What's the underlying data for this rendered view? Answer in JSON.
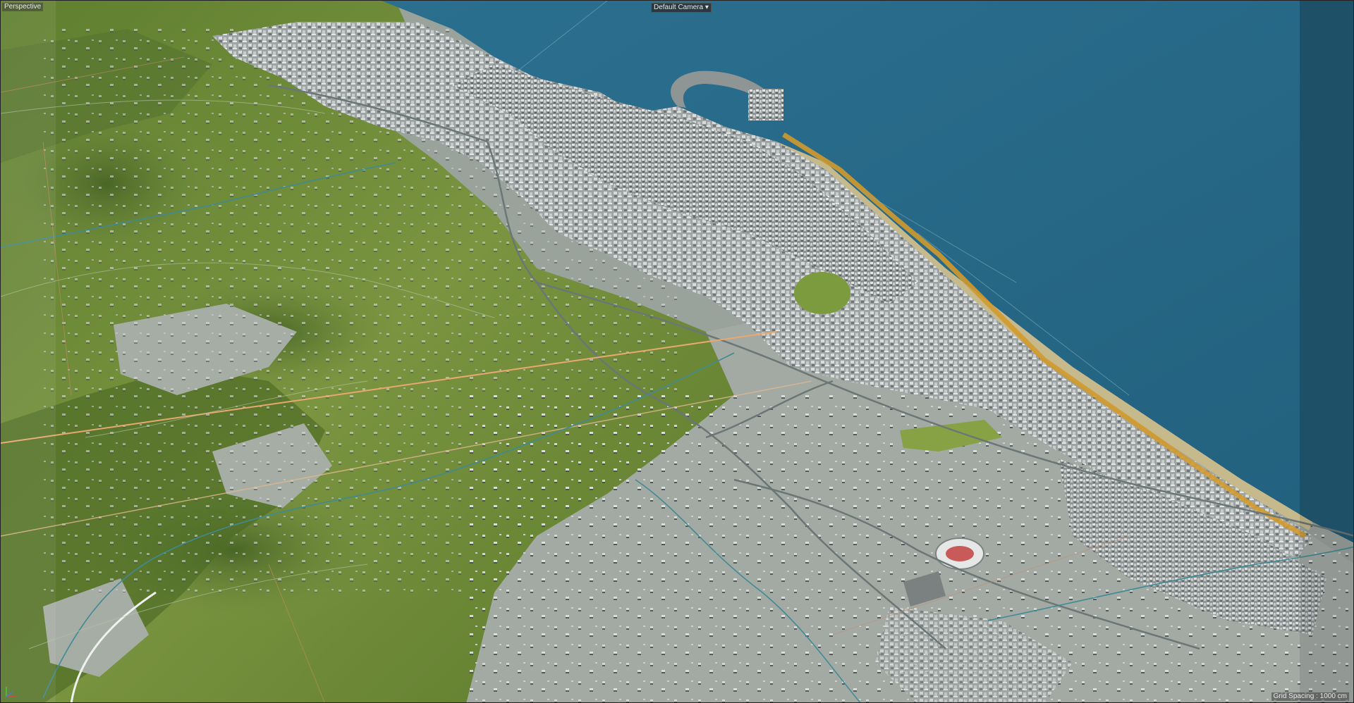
{
  "viewport": {
    "view_label": "Perspective",
    "camera_label": "Default Camera",
    "camera_icon": "camera-dropdown-icon",
    "grid_label": "Grid Spacing : 1000 cm",
    "gizmo_icon": "axis-gizmo-icon"
  },
  "colors": {
    "sea": "#2a6d8c",
    "terrain_green": "#6f8a3a",
    "terrain_dark": "#4e6a2a",
    "urban_gray": "#a9afae",
    "rail_orange": "#d39a2a",
    "beach": "#c8b98a"
  }
}
